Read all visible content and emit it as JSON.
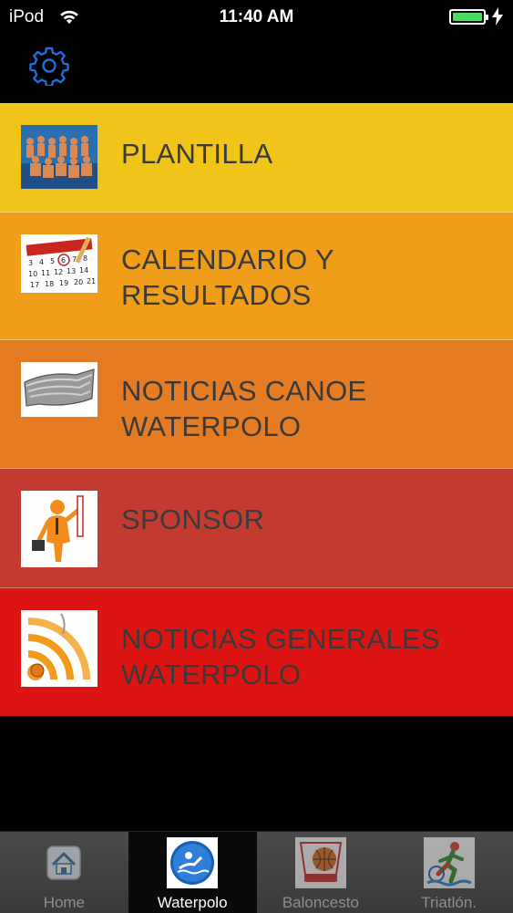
{
  "status_bar": {
    "carrier": "iPod",
    "time": "11:40 AM",
    "wifi_icon": "wifi-icon",
    "battery_icon": "battery-charging-icon",
    "battery_color": "#4cd964"
  },
  "nav_bar": {
    "settings_icon": "gear-icon",
    "accent": "#1e6fd9"
  },
  "menu": {
    "items": [
      {
        "label": "PLANTILLA",
        "icon": "team-photo-icon",
        "color": "#f0c418"
      },
      {
        "label": "CALENDARIO Y RESULTADOS",
        "icon": "calendar-icon",
        "color": "#f09e1a"
      },
      {
        "label": "NOTICIAS CANOE WATERPOLO",
        "icon": "newspaper-icon",
        "color": "#e57c24"
      },
      {
        "label": "SPONSOR",
        "icon": "sponsor-figure-icon",
        "color": "#c33a30"
      },
      {
        "label": "NOTICIAS GENERALES WATERPOLO",
        "icon": "rss-feed-icon",
        "color": "#dd1414"
      }
    ]
  },
  "tab_bar": {
    "tabs": [
      {
        "label": "Home",
        "icon": "home-icon",
        "active": false
      },
      {
        "label": "Waterpolo",
        "icon": "waterpolo-icon",
        "active": true
      },
      {
        "label": "Baloncesto",
        "icon": "basketball-icon",
        "active": false
      },
      {
        "label": "Triatlón.",
        "icon": "triathlon-icon",
        "active": false
      }
    ]
  }
}
